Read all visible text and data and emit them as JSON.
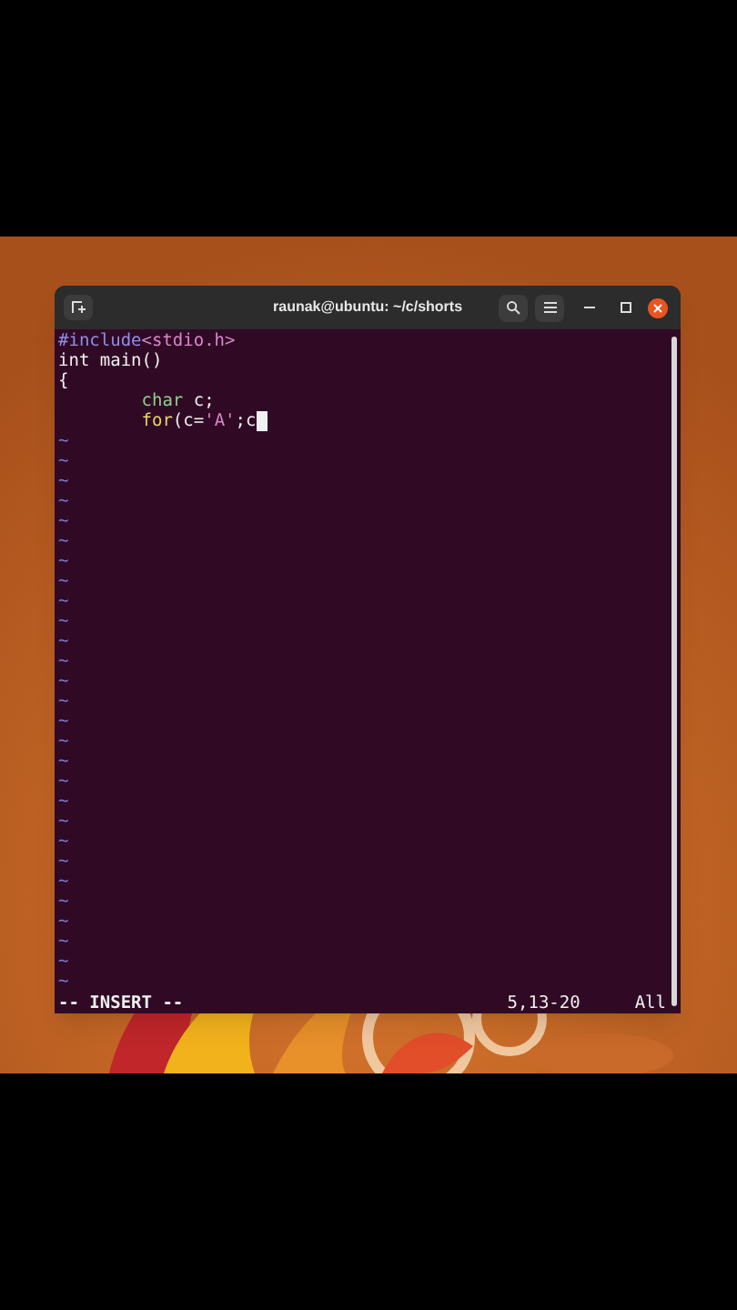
{
  "window": {
    "title": "raunak@ubuntu: ~/c/shorts"
  },
  "editor": {
    "lines": [
      [
        {
          "kind": "preproc",
          "text": "#include"
        },
        {
          "kind": "string",
          "text": "<stdio.h>"
        }
      ],
      [
        {
          "kind": "plain",
          "text": "int main()"
        }
      ],
      [
        {
          "kind": "plain",
          "text": "{"
        }
      ],
      [
        {
          "kind": "indent"
        },
        {
          "kind": "type",
          "text": "char"
        },
        {
          "kind": "plain",
          "text": " c;"
        }
      ],
      [
        {
          "kind": "indent"
        },
        {
          "kind": "keyword",
          "text": "for"
        },
        {
          "kind": "plain",
          "text": "(c="
        },
        {
          "kind": "string",
          "text": "'A'"
        },
        {
          "kind": "plain",
          "text": ";c"
        },
        {
          "kind": "cursor"
        }
      ]
    ]
  },
  "tildes": [
    "~",
    "~",
    "~",
    "~",
    "~",
    "~",
    "~",
    "~",
    "~",
    "~",
    "~",
    "~",
    "~",
    "~",
    "~",
    "~",
    "~",
    "~",
    "~",
    "~",
    "~",
    "~",
    "~",
    "~",
    "~",
    "~",
    "~",
    "~"
  ],
  "status": {
    "mode": "-- INSERT --",
    "position": "5,13-20",
    "scroll": "All"
  }
}
